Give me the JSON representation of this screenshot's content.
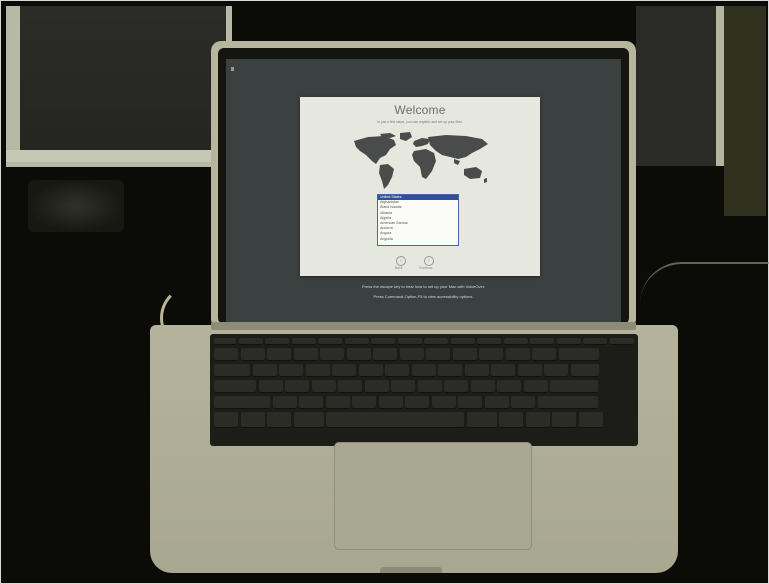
{
  "setup": {
    "title": "Welcome",
    "subtitle": "In just a few steps, you can register and set up your Mac.",
    "countries": [
      {
        "label": "United States",
        "selected": true
      },
      {
        "label": "Afghanistan",
        "selected": false
      },
      {
        "label": "Åland Islands",
        "selected": false
      },
      {
        "label": "Albania",
        "selected": false
      },
      {
        "label": "Algeria",
        "selected": false
      },
      {
        "label": "American Samoa",
        "selected": false
      },
      {
        "label": "Andorra",
        "selected": false
      },
      {
        "label": "Angola",
        "selected": false
      },
      {
        "label": "Anguilla",
        "selected": false
      }
    ],
    "back_label": "Back",
    "continue_label": "Continue",
    "back_icon": "‹",
    "continue_icon": "›"
  },
  "screen_notes": {
    "voiceover_hint": "Press the escape key to hear how to set up your Mac with VoiceOver.",
    "accessibility_hint": "Press Command-Option-F5 to view accessibility options."
  },
  "colors": {
    "selection": "#2f4e9f",
    "window_bg": "#e6e7df",
    "screen_bg": "#3b4040"
  }
}
